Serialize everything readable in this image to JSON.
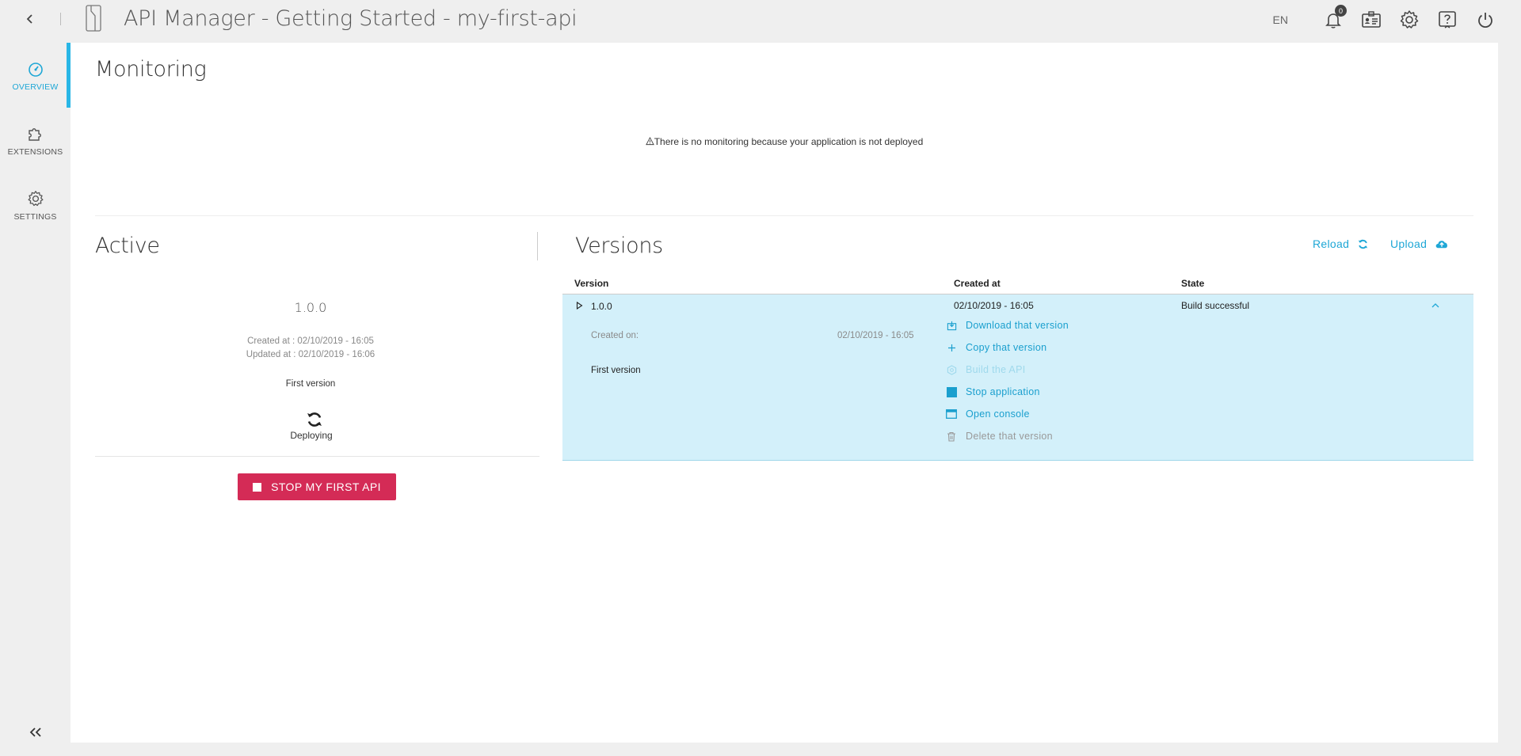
{
  "header": {
    "title": "API Manager - Getting Started - my-first-api",
    "lang": "EN",
    "notifications_count": "0"
  },
  "sidebar": {
    "items": [
      {
        "label": "OVERVIEW",
        "icon": "dashboard-icon",
        "active": true
      },
      {
        "label": "EXTENSIONS",
        "icon": "puzzle-icon",
        "active": false
      },
      {
        "label": "SETTINGS",
        "icon": "gear-icon",
        "active": false
      }
    ]
  },
  "monitoring": {
    "title": "Monitoring",
    "message": "There is no monitoring because your application is not deployed"
  },
  "active": {
    "title": "Active",
    "version": "1.0.0",
    "created": "Created at  : 02/10/2019 - 16:05",
    "updated": "Updated at : 02/10/2019 - 16:06",
    "description": "First version",
    "status": "Deploying",
    "stop_button": "STOP MY FIRST API"
  },
  "versions": {
    "title": "Versions",
    "reload_label": "Reload",
    "upload_label": "Upload",
    "columns": [
      "Version",
      "Created at",
      "State"
    ],
    "rows": [
      {
        "version": "1.0.0",
        "created_at": "02/10/2019 - 16:05",
        "state": "Build successful",
        "created_on_label": "Created on:",
        "created_on_value": "02/10/2019 - 16:05",
        "description": "First version",
        "actions": [
          {
            "label": "Download that version",
            "icon": "download-icon",
            "status": "enabled"
          },
          {
            "label": "Copy that version",
            "icon": "plus-icon",
            "status": "enabled"
          },
          {
            "label": "Build the API",
            "icon": "build-icon",
            "status": "disabled"
          },
          {
            "label": "Stop application",
            "icon": "stop-icon",
            "status": "enabled"
          },
          {
            "label": "Open console",
            "icon": "console-icon",
            "status": "enabled"
          },
          {
            "label": "Delete that version",
            "icon": "trash-icon",
            "status": "danger"
          }
        ]
      }
    ]
  },
  "colors": {
    "accent": "#29b6e6",
    "danger": "#d42b56",
    "row_highlight": "#d3f0fa"
  }
}
